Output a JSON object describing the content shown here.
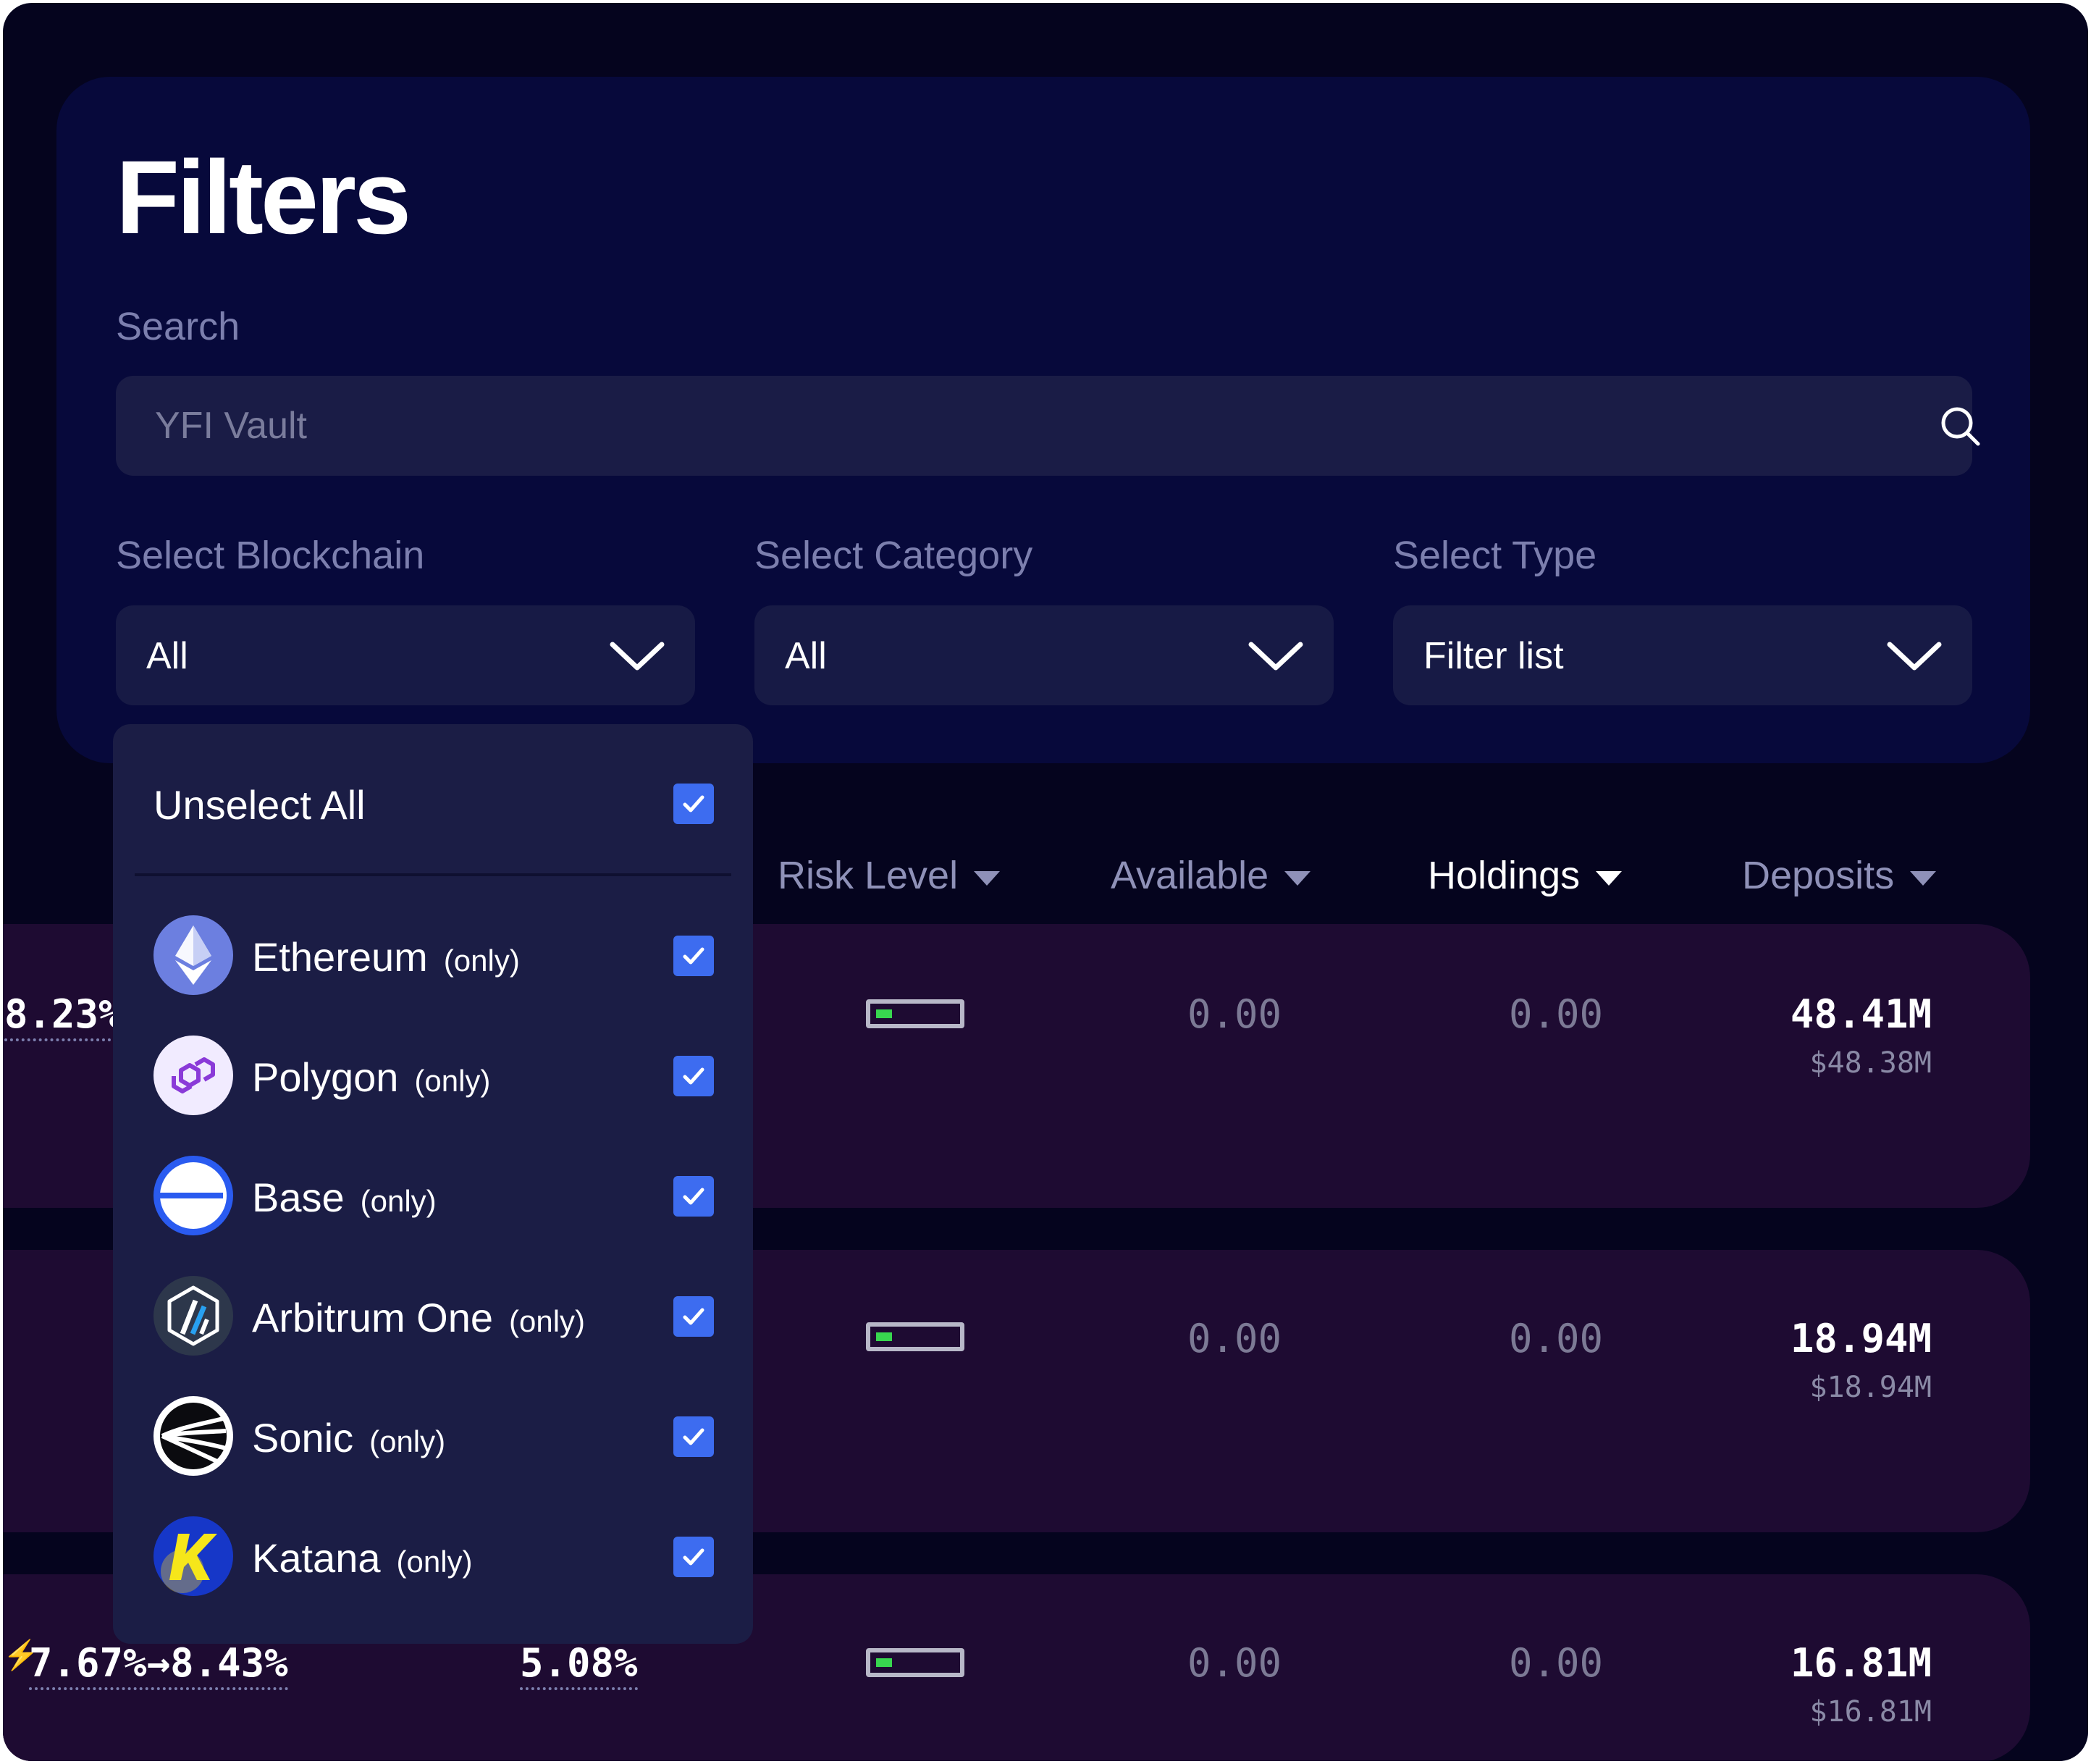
{
  "filters": {
    "title": "Filters",
    "search_label": "Search",
    "search_placeholder": "YFI Vault",
    "blockchain": {
      "label": "Select Blockchain",
      "value": "All"
    },
    "category": {
      "label": "Select Category",
      "value": "All"
    },
    "type": {
      "label": "Select Type",
      "value": "Filter list"
    }
  },
  "dropdown": {
    "unselect_all_label": "Unselect All",
    "only_label": "(only)",
    "chains": [
      {
        "name": "Ethereum",
        "icon": "ethereum-icon",
        "checked": true
      },
      {
        "name": "Polygon",
        "icon": "polygon-icon",
        "checked": true
      },
      {
        "name": "Base",
        "icon": "base-icon",
        "checked": true
      },
      {
        "name": "Arbitrum One",
        "icon": "arbitrum-icon",
        "checked": true
      },
      {
        "name": "Sonic",
        "icon": "sonic-icon",
        "checked": true
      },
      {
        "name": "Katana",
        "icon": "katana-icon",
        "checked": true
      }
    ]
  },
  "table": {
    "columns": {
      "risk": "Risk Level",
      "available": "Available",
      "holdings": "Holdings",
      "deposits": "Deposits"
    },
    "active_column": "Holdings",
    "rows": [
      {
        "apy": "8.23%",
        "risk_level_fraction": 0.2,
        "available": "0.00",
        "holdings": "0.00",
        "deposits": "48.41M",
        "deposits_usd": "$48.38M"
      },
      {
        "apy": "",
        "risk_level_fraction": 0.2,
        "available": "0.00",
        "holdings": "0.00",
        "deposits": "18.94M",
        "deposits_usd": "$18.94M"
      },
      {
        "apy_from": "7.67%",
        "apy_arrow": "→",
        "apy_to": "8.43%",
        "historical_apy": "5.08%",
        "risk_level_fraction": 0.2,
        "available": "0.00",
        "holdings": "0.00",
        "deposits": "16.81M",
        "deposits_usd": "$16.81M"
      }
    ]
  },
  "colors": {
    "background": "#05041e",
    "panel": "#07093b",
    "row": "#1e0b32",
    "checkbox": "#3d6cf0",
    "risk_fill": "#38d64f"
  }
}
